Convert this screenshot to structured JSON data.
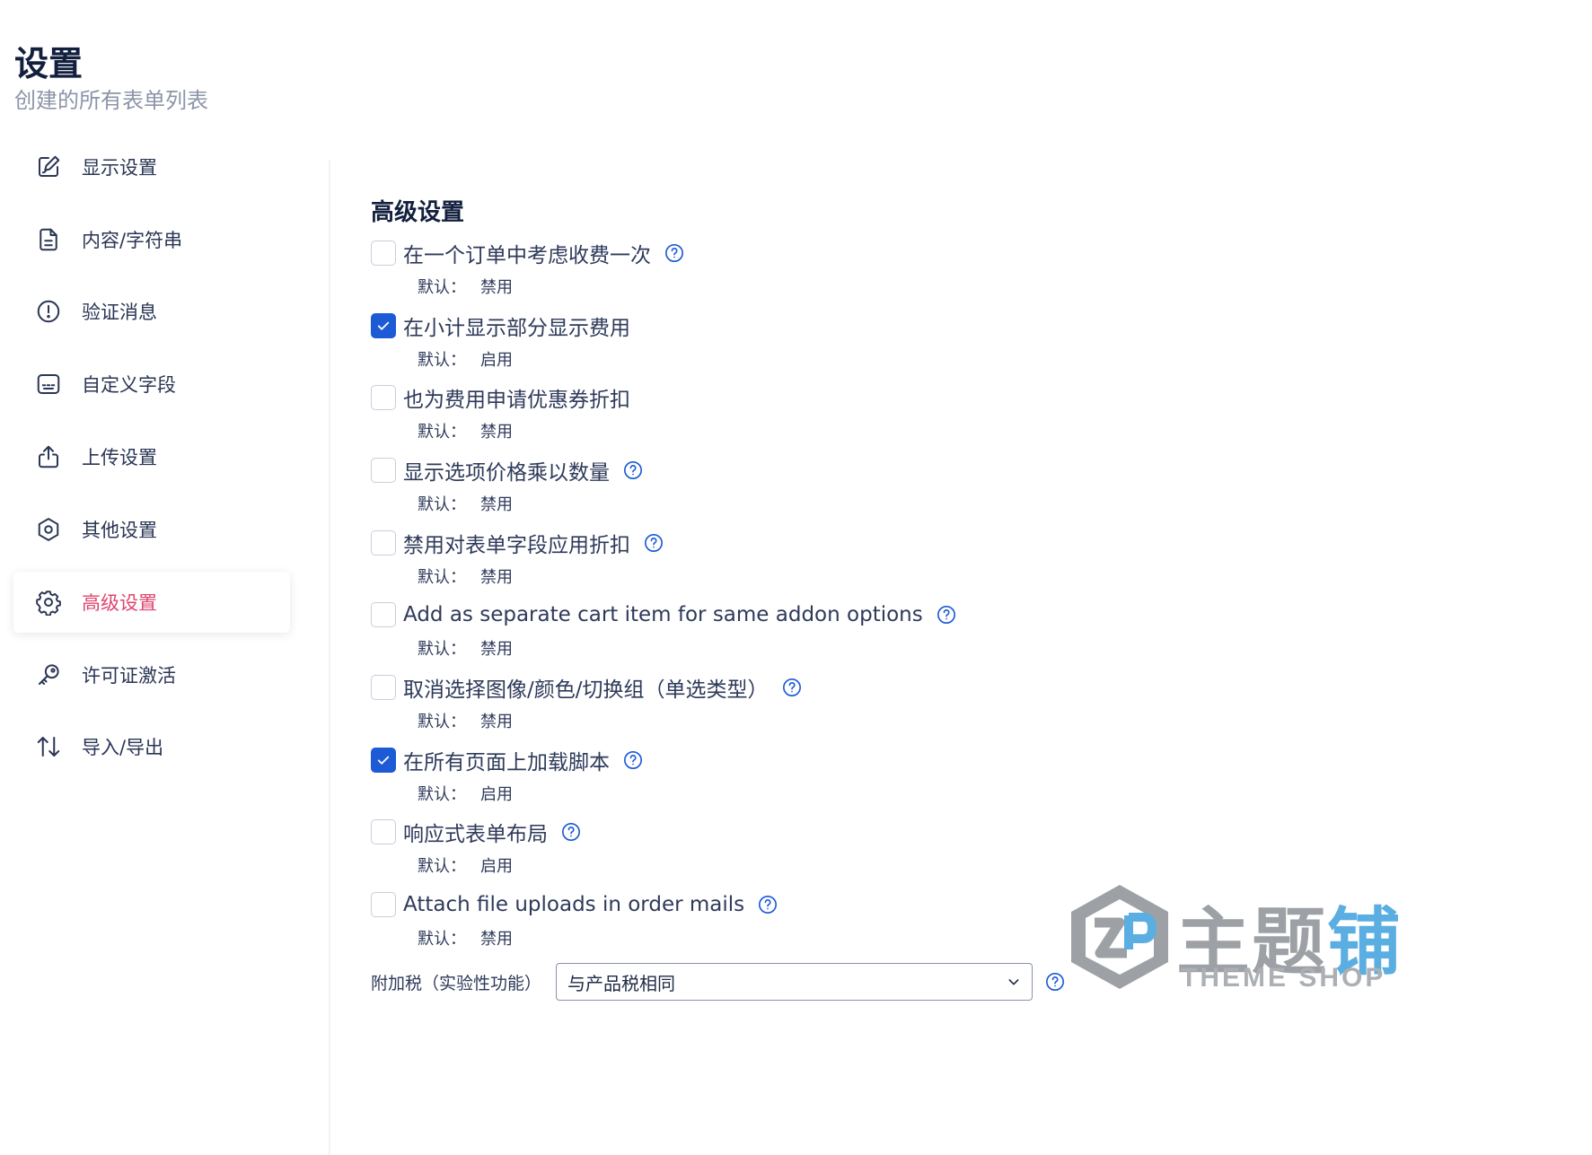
{
  "header": {
    "title": "设置",
    "subtitle": "创建的所有表单列表"
  },
  "sidebar": {
    "items": [
      {
        "label": "显示设置",
        "icon": "brush-edit-icon",
        "active": false
      },
      {
        "label": "内容/字符串",
        "icon": "document-icon",
        "active": false
      },
      {
        "label": "验证消息",
        "icon": "alert-circle-icon",
        "active": false
      },
      {
        "label": "自定义字段",
        "icon": "keyboard-icon",
        "active": false
      },
      {
        "label": "上传设置",
        "icon": "upload-icon",
        "active": false
      },
      {
        "label": "其他设置",
        "icon": "hexagon-gear-icon",
        "active": false
      },
      {
        "label": "高级设置",
        "icon": "gear-icon",
        "active": true
      },
      {
        "label": "许可证激活",
        "icon": "key-icon",
        "active": false
      },
      {
        "label": "导入/导出",
        "icon": "import-export-icon",
        "active": false
      }
    ],
    "active_color": "#e0456f"
  },
  "main": {
    "section_title": "高级设置",
    "default_prefix": "默认：",
    "options": [
      {
        "label": "在一个订单中考虑收费一次",
        "checked": false,
        "help": true,
        "default": "禁用"
      },
      {
        "label": "在小计显示部分显示费用",
        "checked": true,
        "help": false,
        "default": "启用"
      },
      {
        "label": "也为费用申请优惠券折扣",
        "checked": false,
        "help": false,
        "default": "禁用"
      },
      {
        "label": "显示选项价格乘以数量",
        "checked": false,
        "help": true,
        "default": "禁用"
      },
      {
        "label": "禁用对表单字段应用折扣",
        "checked": false,
        "help": true,
        "default": "禁用"
      },
      {
        "label": "Add as separate cart item for same addon options",
        "checked": false,
        "help": true,
        "default": "禁用"
      },
      {
        "label": "取消选择图像/颜色/切换组（单选类型）",
        "checked": false,
        "help": true,
        "default": "禁用"
      },
      {
        "label": "在所有页面上加载脚本",
        "checked": true,
        "help": true,
        "default": "启用"
      },
      {
        "label": "响应式表单布局",
        "checked": false,
        "help": true,
        "default": "启用"
      },
      {
        "label": "Attach file uploads in order mails",
        "checked": false,
        "help": true,
        "default": "禁用"
      }
    ],
    "tax": {
      "label": "附加税（实验性功能）",
      "selected": "与产品税相同"
    },
    "accent_color": "#1d5bd6"
  },
  "watermark": {
    "text": "主题铺",
    "subtext": "THEME SHOP"
  }
}
